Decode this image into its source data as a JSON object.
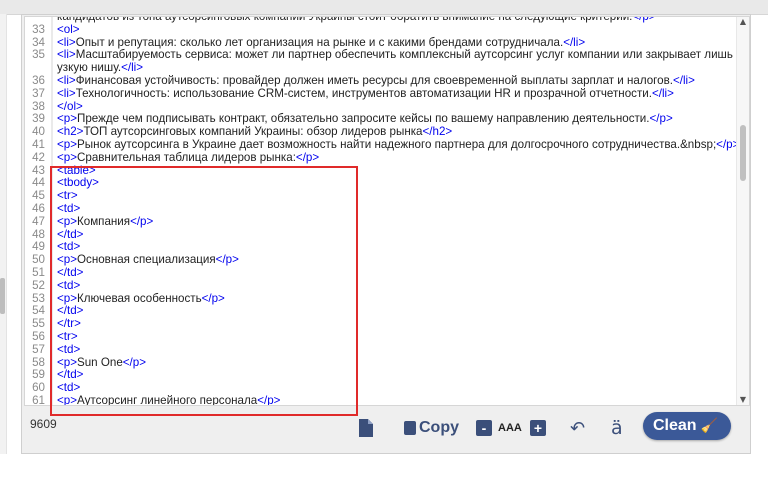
{
  "editor": {
    "lines": [
      {
        "n": "",
        "segs": [
          {
            "t": "кандидатов из топа аутсорсинговых компаний Украины стоит обратить внимание на следующие критерии:",
            "c": "txt"
          },
          {
            "t": "</p>",
            "c": "tag"
          }
        ]
      },
      {
        "n": "33",
        "segs": [
          {
            "t": "<ol>",
            "c": "tag"
          }
        ]
      },
      {
        "n": "34",
        "segs": [
          {
            "t": "<li>",
            "c": "tag"
          },
          {
            "t": "Опыт и репутация: сколько лет организация на рынке и с какими брендами сотрудничала.",
            "c": "txt"
          },
          {
            "t": "</li>",
            "c": "tag"
          }
        ]
      },
      {
        "n": "35",
        "segs": [
          {
            "t": "<li>",
            "c": "tag"
          },
          {
            "t": "Масштабируемость сервиса: может ли партнер обеспечить комплексный аутсорсинг услуг компании или закрывает лишь",
            "c": "txt"
          }
        ]
      },
      {
        "n": "",
        "segs": [
          {
            "t": "узкую нишу.",
            "c": "txt"
          },
          {
            "t": "</li>",
            "c": "tag"
          }
        ]
      },
      {
        "n": "36",
        "segs": [
          {
            "t": "<li>",
            "c": "tag"
          },
          {
            "t": "Финансовая устойчивость: провайдер должен иметь ресурсы для своевременной выплаты зарплат и налогов.",
            "c": "txt"
          },
          {
            "t": "</li>",
            "c": "tag"
          }
        ]
      },
      {
        "n": "37",
        "segs": [
          {
            "t": "<li>",
            "c": "tag"
          },
          {
            "t": "Технологичность: использование CRM-систем, инструментов автоматизации HR и прозрачной отчетности.",
            "c": "txt"
          },
          {
            "t": "</li>",
            "c": "tag"
          }
        ]
      },
      {
        "n": "38",
        "segs": [
          {
            "t": "</ol>",
            "c": "tag"
          }
        ]
      },
      {
        "n": "39",
        "segs": [
          {
            "t": "<p>",
            "c": "tag"
          },
          {
            "t": "Прежде чем подписывать контракт, обязательно запросите кейсы по вашему направлению деятельности.",
            "c": "txt"
          },
          {
            "t": "</p>",
            "c": "tag"
          }
        ]
      },
      {
        "n": "40",
        "segs": [
          {
            "t": "<h2>",
            "c": "tag"
          },
          {
            "t": "ТОП аутсорсинговых компаний Украины: обзор лидеров рынка",
            "c": "txt"
          },
          {
            "t": "</h2>",
            "c": "tag"
          }
        ]
      },
      {
        "n": "41",
        "segs": [
          {
            "t": "<p>",
            "c": "tag"
          },
          {
            "t": "Рынок аутсорсинга в Украине дает возможность найти надежного партнера для долгосрочного сотрудничества.&nbsp;",
            "c": "txt"
          },
          {
            "t": "</p>",
            "c": "tag"
          }
        ]
      },
      {
        "n": "42",
        "segs": [
          {
            "t": "<p>",
            "c": "tag"
          },
          {
            "t": "Сравнительная таблица лидеров рынка:",
            "c": "txt"
          },
          {
            "t": "</p>",
            "c": "tag"
          }
        ]
      },
      {
        "n": "43",
        "segs": [
          {
            "t": "<table>",
            "c": "tag"
          }
        ]
      },
      {
        "n": "44",
        "segs": [
          {
            "t": "<tbody>",
            "c": "tag"
          }
        ]
      },
      {
        "n": "45",
        "segs": [
          {
            "t": "<tr>",
            "c": "tag"
          }
        ]
      },
      {
        "n": "46",
        "segs": [
          {
            "t": "<td>",
            "c": "tag"
          }
        ]
      },
      {
        "n": "47",
        "segs": [
          {
            "t": "<p>",
            "c": "tag"
          },
          {
            "t": "Компания",
            "c": "txt"
          },
          {
            "t": "</p>",
            "c": "tag"
          }
        ]
      },
      {
        "n": "48",
        "segs": [
          {
            "t": "</td>",
            "c": "tag"
          }
        ]
      },
      {
        "n": "49",
        "segs": [
          {
            "t": "<td>",
            "c": "tag"
          }
        ]
      },
      {
        "n": "50",
        "segs": [
          {
            "t": "<p>",
            "c": "tag"
          },
          {
            "t": "Основная специализация",
            "c": "txt"
          },
          {
            "t": "</p>",
            "c": "tag"
          }
        ]
      },
      {
        "n": "51",
        "segs": [
          {
            "t": "</td>",
            "c": "tag"
          }
        ]
      },
      {
        "n": "52",
        "segs": [
          {
            "t": "<td>",
            "c": "tag"
          }
        ]
      },
      {
        "n": "53",
        "segs": [
          {
            "t": "<p>",
            "c": "tag"
          },
          {
            "t": "Ключевая особенность",
            "c": "txt"
          },
          {
            "t": "</p>",
            "c": "tag"
          }
        ]
      },
      {
        "n": "54",
        "segs": [
          {
            "t": "</td>",
            "c": "tag"
          }
        ]
      },
      {
        "n": "55",
        "segs": [
          {
            "t": "</tr>",
            "c": "tag"
          }
        ]
      },
      {
        "n": "56",
        "segs": [
          {
            "t": "<tr>",
            "c": "tag"
          }
        ]
      },
      {
        "n": "57",
        "segs": [
          {
            "t": "<td>",
            "c": "tag"
          }
        ]
      },
      {
        "n": "58",
        "segs": [
          {
            "t": "<p>",
            "c": "tag"
          },
          {
            "t": "Sun One",
            "c": "txt"
          },
          {
            "t": "</p>",
            "c": "tag"
          }
        ]
      },
      {
        "n": "59",
        "segs": [
          {
            "t": "</td>",
            "c": "tag"
          }
        ]
      },
      {
        "n": "60",
        "segs": [
          {
            "t": "<td>",
            "c": "tag"
          }
        ]
      },
      {
        "n": "61",
        "segs": [
          {
            "t": "<p>",
            "c": "tag"
          },
          {
            "t": "Аутсорсинг линейного персонала",
            "c": "txt"
          },
          {
            "t": "</p>",
            "c": "tag"
          }
        ]
      }
    ]
  },
  "status": {
    "char_count": "9609"
  },
  "toolbar": {
    "copy_label": "Copy",
    "minus_label": "-",
    "aaa_label": "AAA",
    "plus_label": "+",
    "ae_label": "ä",
    "clean_label": "Clean"
  },
  "icons": [
    "document-icon",
    "copy-icon",
    "undo-icon",
    "broom-icon"
  ],
  "colors": {
    "accent": "#3b5998",
    "tag": "#0000ee",
    "highlight": "#e02a2a"
  }
}
